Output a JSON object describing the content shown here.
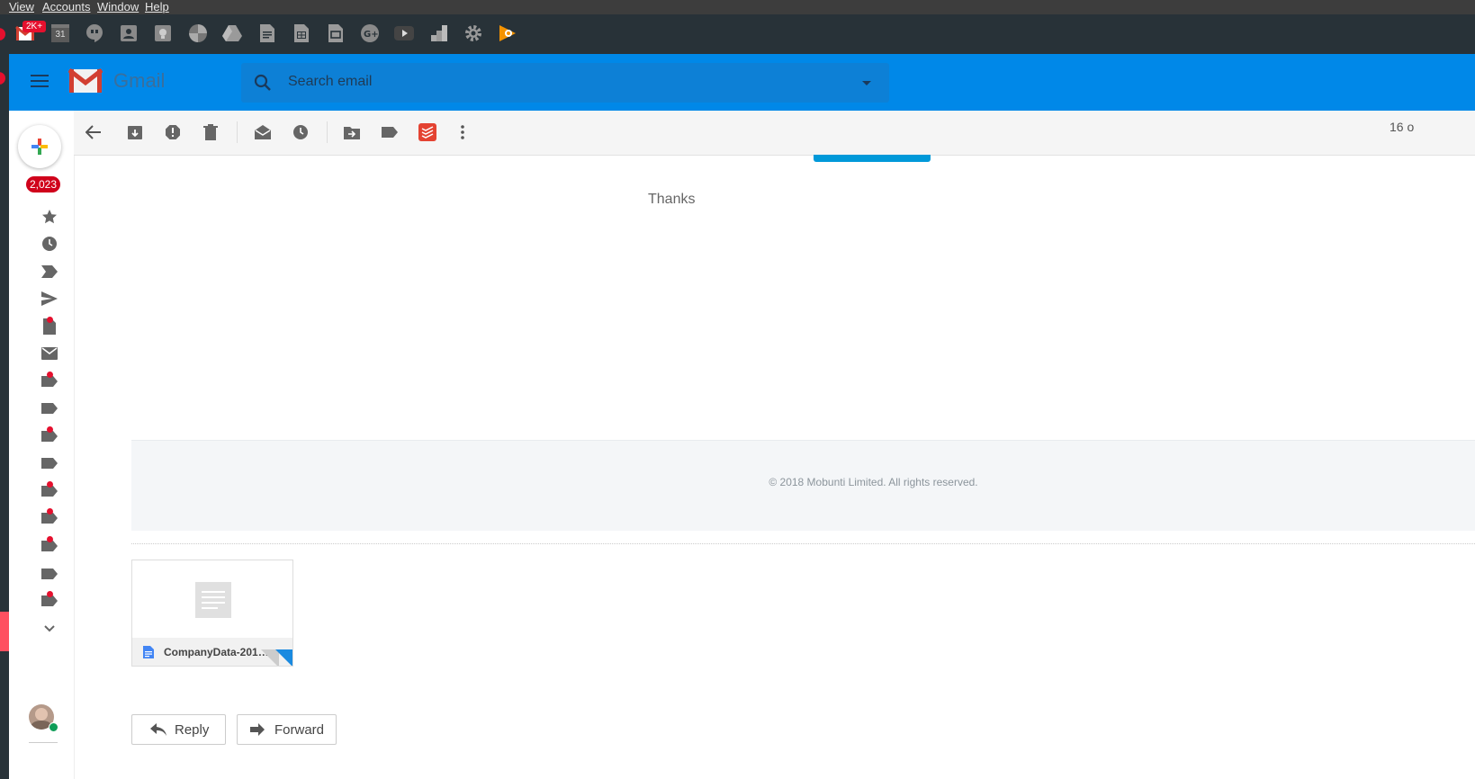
{
  "menubar": {
    "items": [
      "View",
      "Accounts",
      "Window",
      "Help"
    ]
  },
  "appbar": {
    "gmail_badge": "2K+",
    "calendar_day": "31",
    "apps": [
      "gmail-icon",
      "calendar-icon",
      "hangouts-icon",
      "contacts-icon",
      "keep-icon",
      "photos-icon",
      "drive-icon",
      "docs-icon",
      "sheets-icon",
      "slides-icon",
      "google-plus-icon",
      "youtube-icon",
      "analytics-icon",
      "settings-icon",
      "play-music-icon"
    ]
  },
  "header": {
    "app_name": "Gmail",
    "search_placeholder": "Search email"
  },
  "toolbar": {
    "page_indicator": "16 o"
  },
  "nav": {
    "inbox_count": "2,023"
  },
  "email": {
    "thanks_text": "Thanks",
    "footer_text": "© 2018 Mobunti Limited. All rights reserved.",
    "attachment_name": "CompanyData-201…"
  },
  "actions": {
    "reply_label": "Reply",
    "forward_label": "Forward"
  },
  "colors": {
    "header_blue": "#0088e8",
    "accent_red": "#e5102e",
    "email_button_blue": "#0099d9"
  }
}
